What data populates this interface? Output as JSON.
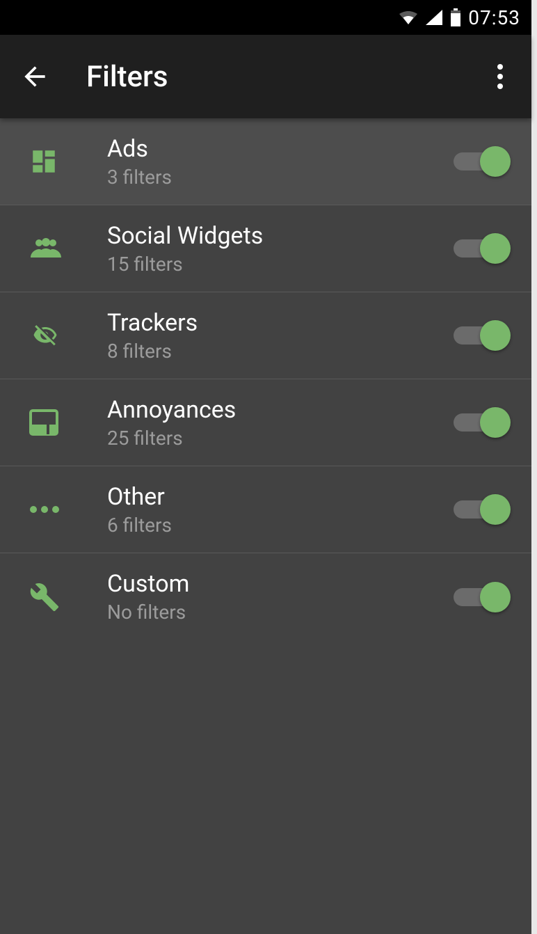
{
  "status_bar": {
    "time": "07:53"
  },
  "header": {
    "title": "Filters"
  },
  "accent_color": "#79b76a",
  "rows": [
    {
      "icon": "dashboard-icon",
      "title": "Ads",
      "subtitle": "3 filters",
      "enabled": true,
      "highlight": true
    },
    {
      "icon": "people-icon",
      "title": "Social Widgets",
      "subtitle": "15 filters",
      "enabled": true,
      "highlight": false
    },
    {
      "icon": "eye-off-icon",
      "title": "Trackers",
      "subtitle": "8 filters",
      "enabled": true,
      "highlight": false
    },
    {
      "icon": "window-icon",
      "title": "Annoyances",
      "subtitle": "25 filters",
      "enabled": true,
      "highlight": false
    },
    {
      "icon": "more-horiz-icon",
      "title": "Other",
      "subtitle": "6 filters",
      "enabled": true,
      "highlight": false
    },
    {
      "icon": "wrench-icon",
      "title": "Custom",
      "subtitle": "No filters",
      "enabled": true,
      "highlight": false
    }
  ]
}
